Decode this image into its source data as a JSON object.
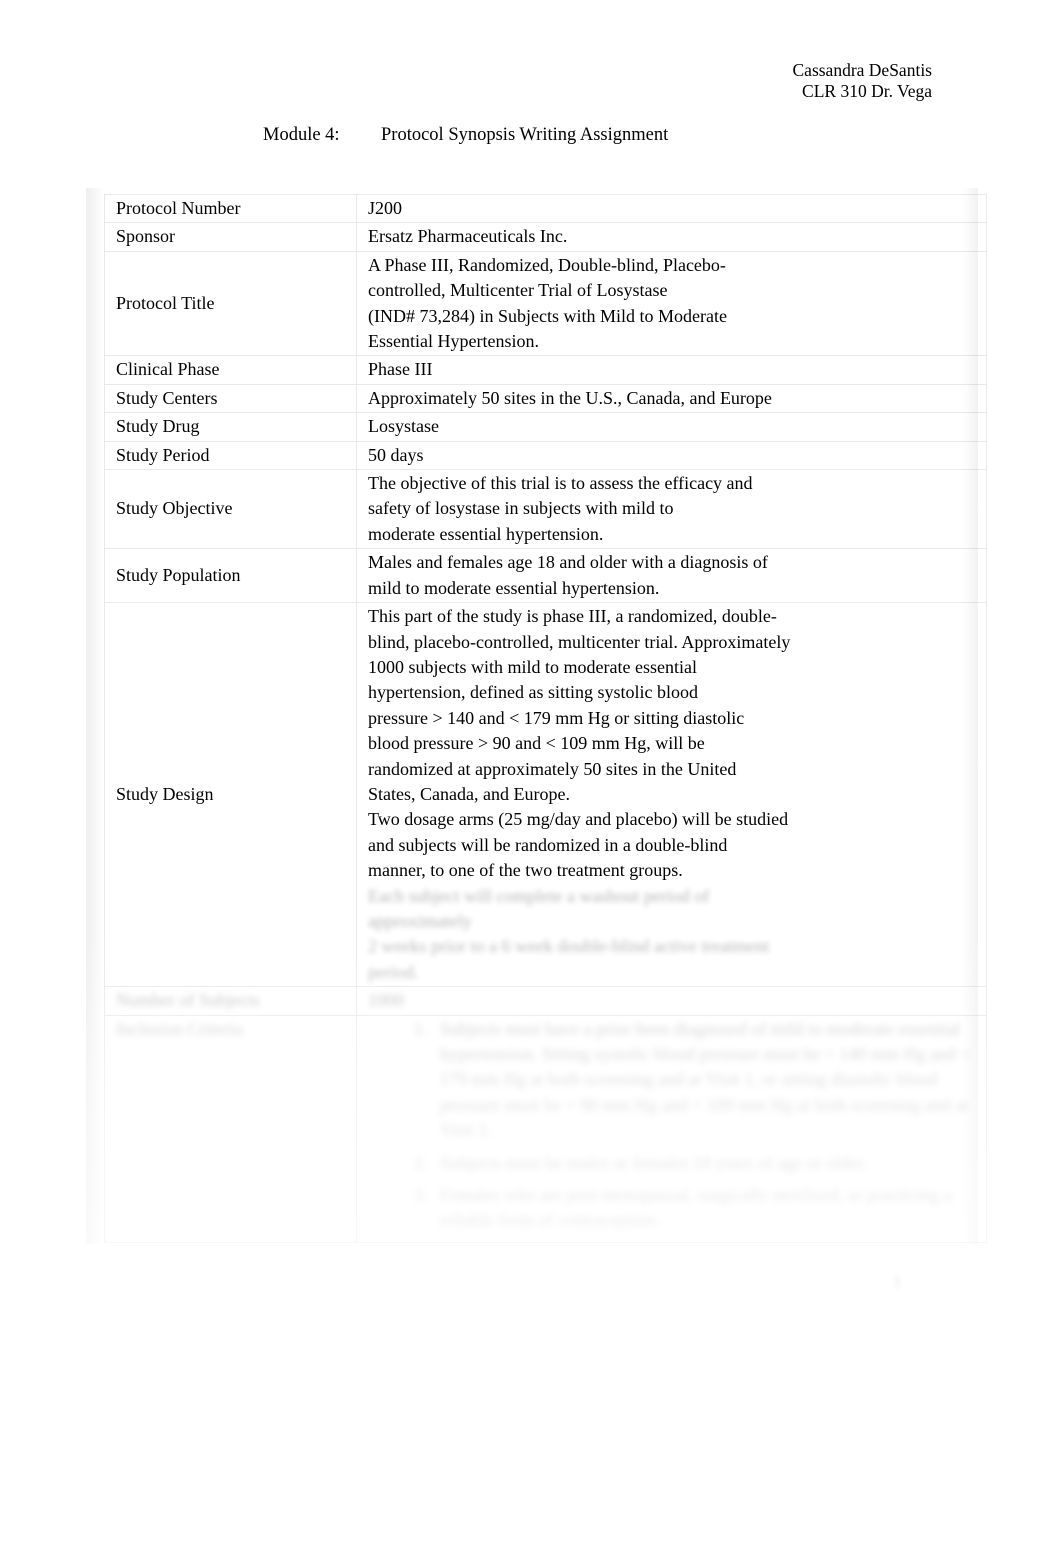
{
  "header": {
    "author": "Cassandra DeSantis",
    "course": "CLR 310 Dr. Vega"
  },
  "assignment": {
    "module_label": "Module 4:",
    "title": "Protocol Synopsis Writing Assignment"
  },
  "table": {
    "rows": [
      {
        "key": "Protocol Number",
        "value_lines": [
          "J200"
        ]
      },
      {
        "key": "Sponsor",
        "value_lines": [
          "Ersatz Pharmaceuticals Inc."
        ]
      },
      {
        "key": "Protocol Title",
        "value_lines": [
          "A Phase III, Randomized, Double-blind, Placebo-",
          "controlled, Multicenter Trial of Losystase",
          "(IND# 73,284) in Subjects with Mild to Moderate",
          "Essential Hypertension."
        ]
      },
      {
        "key": "Clinical Phase",
        "value_lines": [
          "Phase III"
        ]
      },
      {
        "key": "Study Centers",
        "value_lines": [
          "Approximately 50 sites in the U.S., Canada, and Europe"
        ]
      },
      {
        "key": "Study Drug",
        "value_lines": [
          "Losystase"
        ]
      },
      {
        "key": "Study Period",
        "value_lines": [
          "50 days"
        ]
      },
      {
        "key": "Study Objective",
        "value_lines": [
          "The objective of this trial is to assess the efficacy and",
          "safety of losystase in subjects with mild to",
          "moderate essential hypertension."
        ]
      },
      {
        "key": "Study Population",
        "value_lines": [
          "Males and females age 18 and older with a diagnosis of",
          "mild to moderate essential hypertension."
        ]
      },
      {
        "key": "Study Design",
        "value_lines": [
          "This part of the study is phase III, a randomized, double-",
          "blind, placebo-controlled, multicenter trial. Approximately",
          "1000 subjects with mild to moderate essential",
          "hypertension, defined as sitting systolic blood",
          "pressure > 140 and < 179 mm Hg or sitting diastolic",
          "blood pressure > 90 and < 109 mm Hg, will be",
          "randomized at approximately 50 sites in the United",
          "States, Canada, and Europe.",
          "Two dosage arms (25 mg/day and placebo) will be studied",
          "and subjects will be randomized in a double-blind",
          "manner, to one of the two treatment groups."
        ],
        "obscured_lines": [
          "Each subject will complete a washout period of",
          "approximately",
          "2 weeks prior to a 6 week double-blind active treatment",
          "period."
        ]
      },
      {
        "key": "Number of Subjects",
        "key_obscured": true,
        "value_lines": [
          "1000"
        ],
        "value_obscured": true
      },
      {
        "key": "Inclusion Criteria",
        "key_obscured": true,
        "criteria": [
          "Subjects must have a prior been diagnosed of mild to moderate essential hypertension. Sitting systolic blood pressure must be > 140 mm Hg and < 179 mm Hg at both screening and at Visit 1, or sitting diastolic blood pressure must be > 90 mm Hg and < 109 mm Hg at both screening and at Visit 1.",
          "Subjects must be males or females 18 years of age or older.",
          "Females who are post-menopausal, surgically sterilized, or practicing a reliable form of contraception."
        ],
        "criteria_obscured": true
      }
    ]
  },
  "page_number": "1"
}
